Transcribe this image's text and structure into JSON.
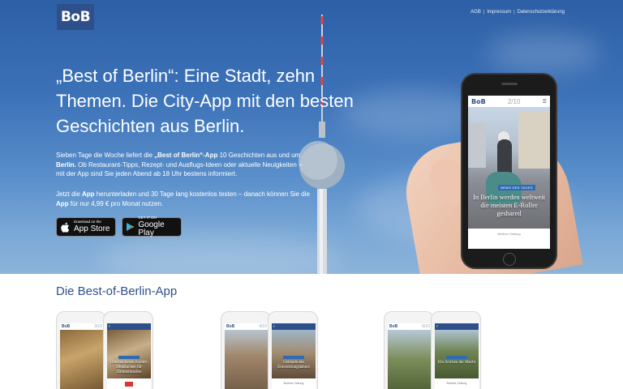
{
  "brand": {
    "logo": "BoB"
  },
  "toplinks": [
    "AGB",
    "Impressum",
    "Datenschutzerklärung"
  ],
  "hero": {
    "headline": "„Best of Berlin“: Eine Stadt, zehn Themen. Die City-App mit den besten Geschichten aus Berlin.",
    "para1": {
      "t1": "Sieben Tage die Woche liefert die ",
      "b1": "„Best of Berlin“-App",
      "t2": " 10 Geschichten aus und um ",
      "b2": "Berlin.",
      "t3": " Ob Restaurant-Tipps, Rezept- und Ausflugs-Ideen oder aktuelle Neuigkeiten –",
      "t4": "mit der App sind Sie jeden Abend ab 18 Uhr bestens informiert."
    },
    "para2": {
      "t1": "Jetzt die ",
      "b1": "App",
      "t2": " herunterladen und 30 Tage lang kostenlos testen – danach können Sie die",
      "b2": "App",
      "t3": " für nur 4,99 € pro Monat nutzen."
    },
    "appstore": {
      "small": "Download on the",
      "big": "App Store"
    },
    "googleplay": {
      "small": "GET IT ON",
      "big": "Google Play"
    }
  },
  "phone": {
    "logo": "BoB",
    "page": "2/10",
    "tag": "NEWS DES TAGES",
    "caption": "In Berlin werden weltweit die meisten E-Roller geshared",
    "footer": "Berliner Zeitung"
  },
  "section": {
    "title": "Die Best-of-Berlin-App",
    "pairs": [
      {
        "left_logo": "BoB",
        "left_page": "3/10",
        "right_caption": "Überraschende Kombi: Dinnkuchen für Zimmermacher"
      },
      {
        "left_logo": "BoB",
        "left_page": "4/10",
        "right_caption": "Gebäude des Entwicklungslabors"
      },
      {
        "left_logo": "BoB",
        "left_page": "6/10",
        "right_caption": "Ein Zeichen der Macht"
      }
    ],
    "footer": "Berliner Zeitung"
  },
  "colors": {
    "brand": "#2e4f8a",
    "sky_top": "#2d5fa6",
    "accent": "#2e6bb5"
  }
}
